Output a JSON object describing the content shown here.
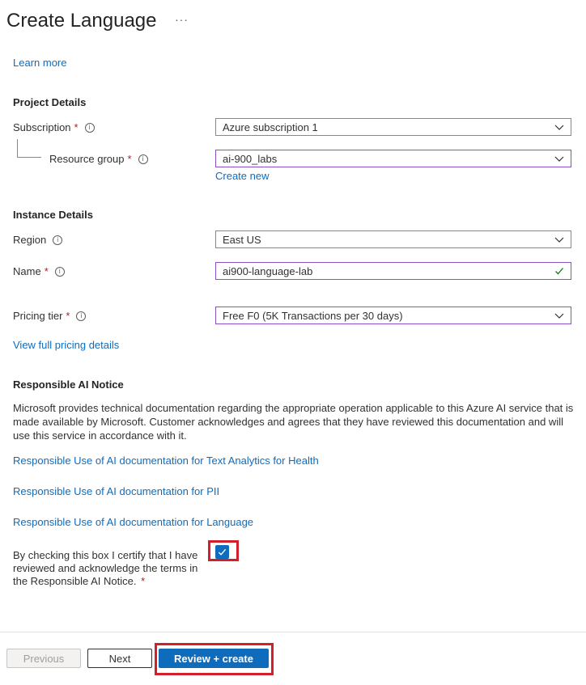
{
  "header": {
    "title": "Create Language",
    "more_label": "···"
  },
  "learn_more": "Learn more",
  "project": {
    "heading": "Project Details",
    "subscription": {
      "label": "Subscription",
      "required": "*",
      "value": "Azure subscription 1"
    },
    "resource_group": {
      "label": "Resource group",
      "required": "*",
      "value": "ai-900_labs",
      "create_new": "Create new"
    }
  },
  "instance": {
    "heading": "Instance Details",
    "region": {
      "label": "Region",
      "value": "East US"
    },
    "name": {
      "label": "Name",
      "required": "*",
      "value": "ai900-language-lab"
    },
    "pricing": {
      "label": "Pricing tier",
      "required": "*",
      "value": "Free F0 (5K Transactions per 30 days)"
    },
    "pricing_link": "View full pricing details"
  },
  "responsible": {
    "heading": "Responsible AI Notice",
    "text": "Microsoft provides technical documentation regarding the appropriate operation applicable to this Azure AI service that is made available by Microsoft. Customer acknowledges and agrees that they have reviewed this documentation and will use this service in accordance with it.",
    "links": [
      "Responsible Use of AI documentation for Text Analytics for Health",
      "Responsible Use of AI documentation for PII",
      "Responsible Use of AI documentation for Language"
    ],
    "certify_text": "By checking this box I certify that I have reviewed and acknowledge the terms in the Responsible AI Notice.",
    "certify_required": "*",
    "checked": true
  },
  "footer": {
    "previous": "Previous",
    "next": "Next",
    "review_create": "Review + create"
  },
  "colors": {
    "accent": "#0f6cbd",
    "highlight": "#d1202c",
    "focus_border": "#8e4ec6",
    "valid_check": "#107c10"
  }
}
